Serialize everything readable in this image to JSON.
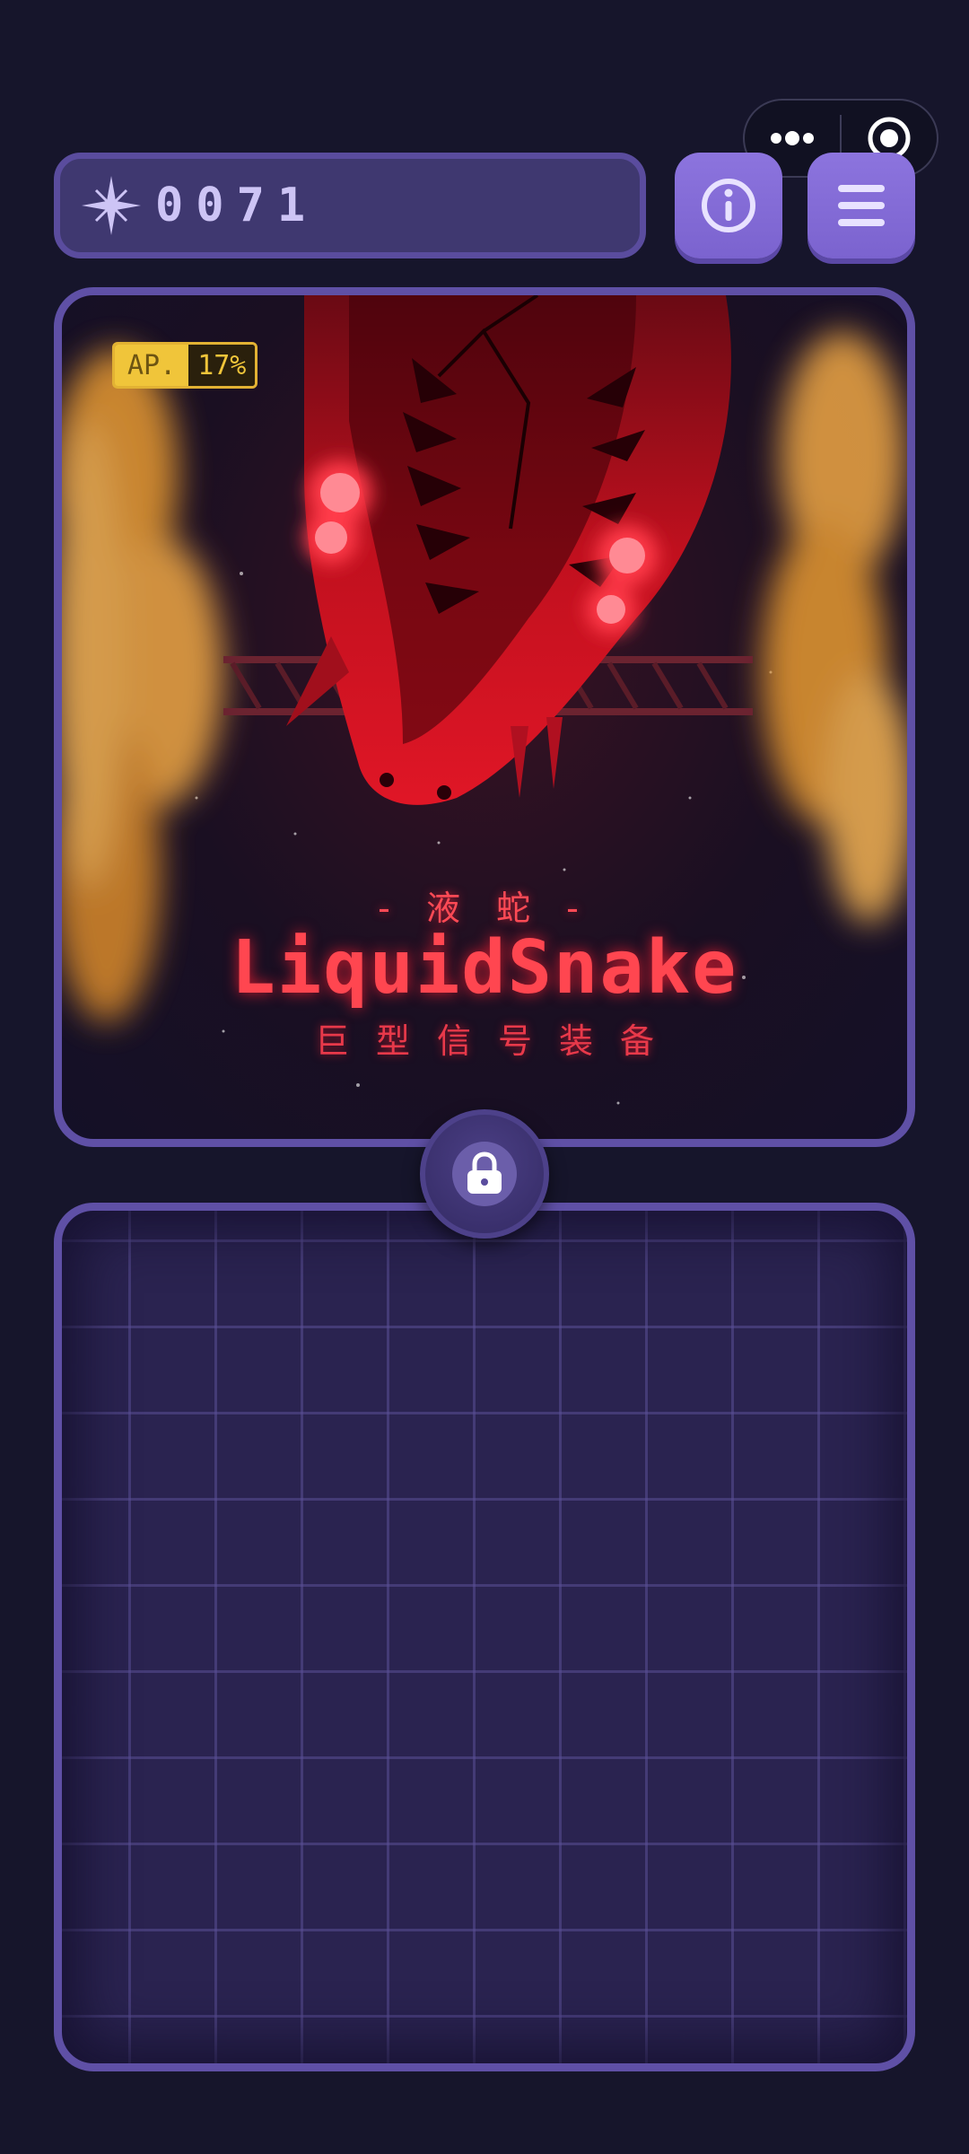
{
  "capsule": {
    "menu_icon": "more-dots-icon",
    "close_icon": "target-circle-icon"
  },
  "header": {
    "score_icon": "sparkle-star-icon",
    "score_value": "0071",
    "info_icon": "info-icon",
    "menu_icon": "hamburger-menu-icon"
  },
  "poster": {
    "ap_label": "AP.",
    "ap_value": "17%",
    "subtitle": "- 液 蛇 -",
    "title": "LiquidSnake",
    "tagline": "巨型信号装备",
    "colors": {
      "accent_red": "#ff4650",
      "badge_yellow": "#f0c53a",
      "frame_purple": "#5f50a6"
    }
  },
  "lock": {
    "icon": "padlock-icon"
  },
  "board": {
    "grid_icon": "empty-grid"
  }
}
